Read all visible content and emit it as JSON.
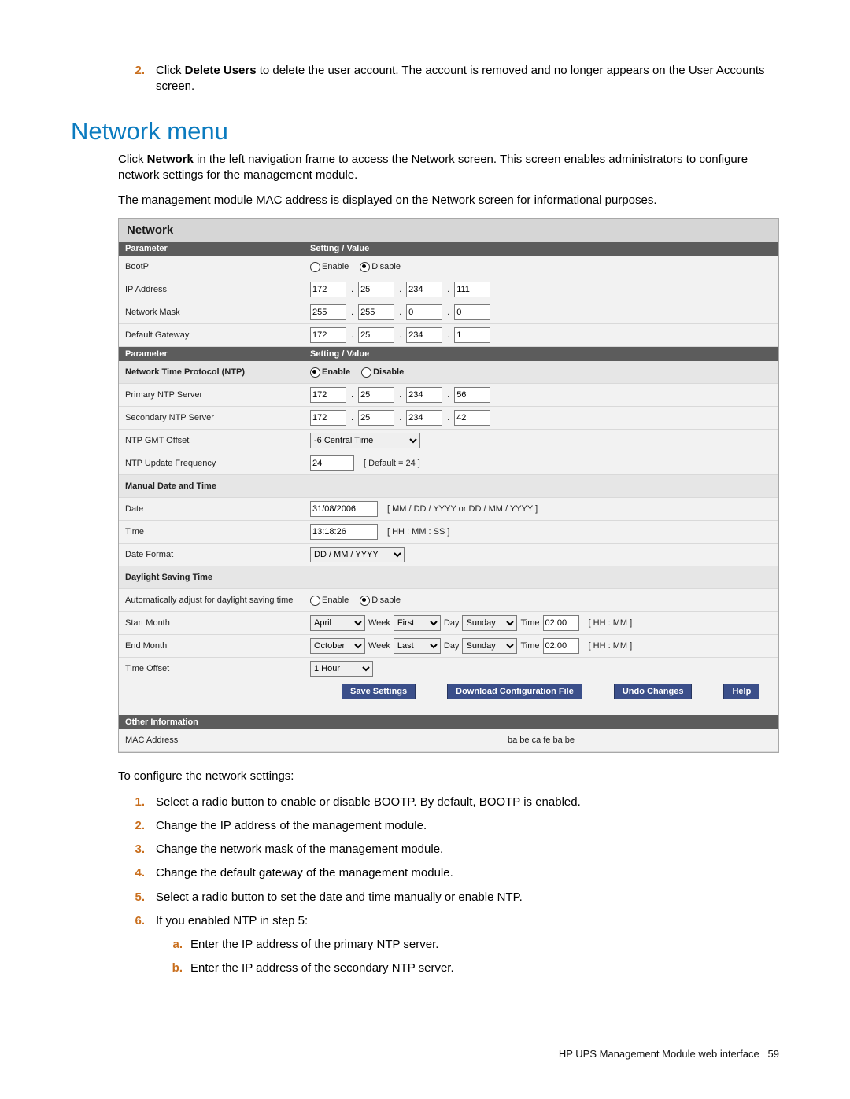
{
  "intro_step": {
    "num": "2.",
    "pre": "Click ",
    "bold": "Delete Users",
    "post": " to delete the user account. The account is removed and no longer appears on the User Accounts screen."
  },
  "heading": "Network menu",
  "para1_pre": "Click ",
  "para1_bold": "Network",
  "para1_post": " in the left navigation frame to access the Network screen. This screen enables administrators to configure network settings for the management module.",
  "para2": "The management module MAC address is displayed on the Network screen for informational purposes.",
  "screenshot": {
    "title": "Network",
    "hdr_param": "Parameter",
    "hdr_value": "Setting / Value",
    "bootp": {
      "label": "BootP",
      "enable": "Enable",
      "disable": "Disable"
    },
    "ip": {
      "label": "IP Address",
      "a": "172",
      "b": "25",
      "c": "234",
      "d": "111"
    },
    "mask": {
      "label": "Network Mask",
      "a": "255",
      "b": "255",
      "c": "0",
      "d": "0"
    },
    "gw": {
      "label": "Default Gateway",
      "a": "172",
      "b": "25",
      "c": "234",
      "d": "1"
    },
    "ntp_section": "Network Time Protocol (NTP)",
    "ntp_radio": {
      "enable": "Enable",
      "disable": "Disable"
    },
    "pntp": {
      "label": "Primary NTP Server",
      "a": "172",
      "b": "25",
      "c": "234",
      "d": "56"
    },
    "sntp": {
      "label": "Secondary NTP Server",
      "a": "172",
      "b": "25",
      "c": "234",
      "d": "42"
    },
    "gmt": {
      "label": "NTP GMT Offset",
      "value": "-6 Central Time"
    },
    "freq": {
      "label": "NTP Update Frequency",
      "value": "24",
      "hint": "[ Default = 24 ]"
    },
    "manual_section": "Manual Date and Time",
    "date": {
      "label": "Date",
      "value": "31/08/2006",
      "hint": "[ MM / DD / YYYY or DD / MM / YYYY ]"
    },
    "time": {
      "label": "Time",
      "value": "13:18:26",
      "hint": "[ HH : MM : SS ]"
    },
    "datefmt": {
      "label": "Date Format",
      "value": "DD / MM / YYYY"
    },
    "dst_section": "Daylight Saving Time",
    "dst_auto": {
      "label": "Automatically adjust for daylight saving time",
      "enable": "Enable",
      "disable": "Disable"
    },
    "start": {
      "label": "Start Month",
      "month": "April",
      "week_lbl": "Week",
      "week": "First",
      "day_lbl": "Day",
      "day": "Sunday",
      "time_lbl": "Time",
      "time": "02:00",
      "hint": "[ HH : MM ]"
    },
    "end": {
      "label": "End Month",
      "month": "October",
      "week_lbl": "Week",
      "week": "Last",
      "day_lbl": "Day",
      "day": "Sunday",
      "time_lbl": "Time",
      "time": "02:00",
      "hint": "[ HH : MM ]"
    },
    "offset": {
      "label": "Time Offset",
      "value": "1 Hour"
    },
    "buttons": {
      "save": "Save Settings",
      "download": "Download Configuration File",
      "undo": "Undo Changes",
      "help": "Help"
    },
    "other_hdr": "Other Information",
    "mac": {
      "label": "MAC Address",
      "value": "ba be ca fe ba be"
    }
  },
  "config_intro": "To configure the network settings:",
  "steps": {
    "s1": {
      "n": "1.",
      "t": "Select a radio button to enable or disable BOOTP. By default, BOOTP is enabled."
    },
    "s2": {
      "n": "2.",
      "t": "Change the IP address of the management module."
    },
    "s3": {
      "n": "3.",
      "t": "Change the network mask of the management module."
    },
    "s4": {
      "n": "4.",
      "t": "Change the default gateway of the management module."
    },
    "s5": {
      "n": "5.",
      "t": "Select a radio button to set the date and time manually or enable NTP."
    },
    "s6": {
      "n": "6.",
      "t": "If you enabled NTP in step 5:"
    },
    "sa": {
      "n": "a.",
      "t": "Enter the IP address of the primary NTP server."
    },
    "sb": {
      "n": "b.",
      "t": "Enter the IP address of the secondary NTP server."
    }
  },
  "footer": {
    "text": "HP UPS Management Module web interface",
    "page": "59"
  }
}
